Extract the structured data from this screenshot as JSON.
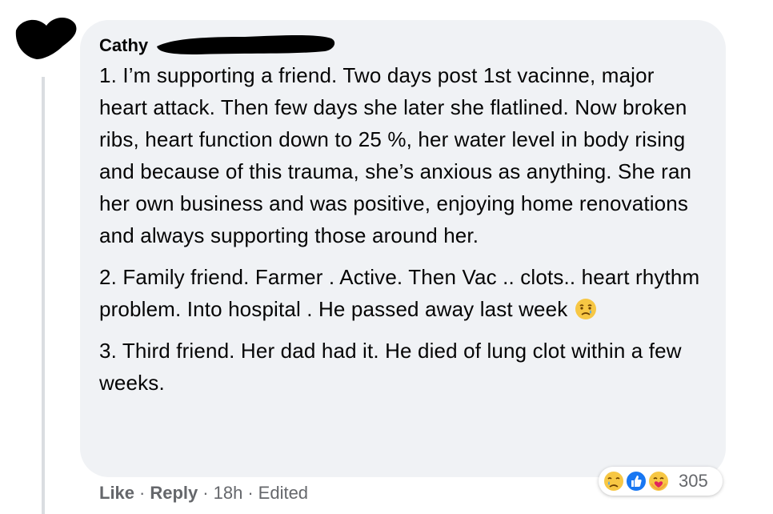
{
  "comment": {
    "author": "Cathy",
    "paragraphs": [
      "1. I’m supporting a friend. Two days post 1st vacinne, major heart attack. Then few days she later she flatlined. Now broken ribs, heart function down to 25 %, her water level in body rising and because of this trauma, she’s anxious as anything. She ran her own business and was positive, enjoying home renovations and always supporting those around her.",
      "2. Family friend. Farmer . Active. Then Vac .. clots.. heart rhythm problem. Into hospital . He passed away last week",
      "3. Third friend. Her dad had it. He died of lung clot within a few weeks."
    ],
    "inline_emoji": "sad-tear-face-icon"
  },
  "actions": {
    "like": "Like",
    "reply": "Reply",
    "dot": "·",
    "time": "18h",
    "edited": "Edited"
  },
  "reactions": {
    "icons": [
      "sad-reaction-icon",
      "like-reaction-icon",
      "care-reaction-icon"
    ],
    "count": "305"
  },
  "colors": {
    "bubble": "#f0f2f5",
    "text": "#050505",
    "secondary": "#65676b",
    "like_blue": "#1877f2"
  }
}
